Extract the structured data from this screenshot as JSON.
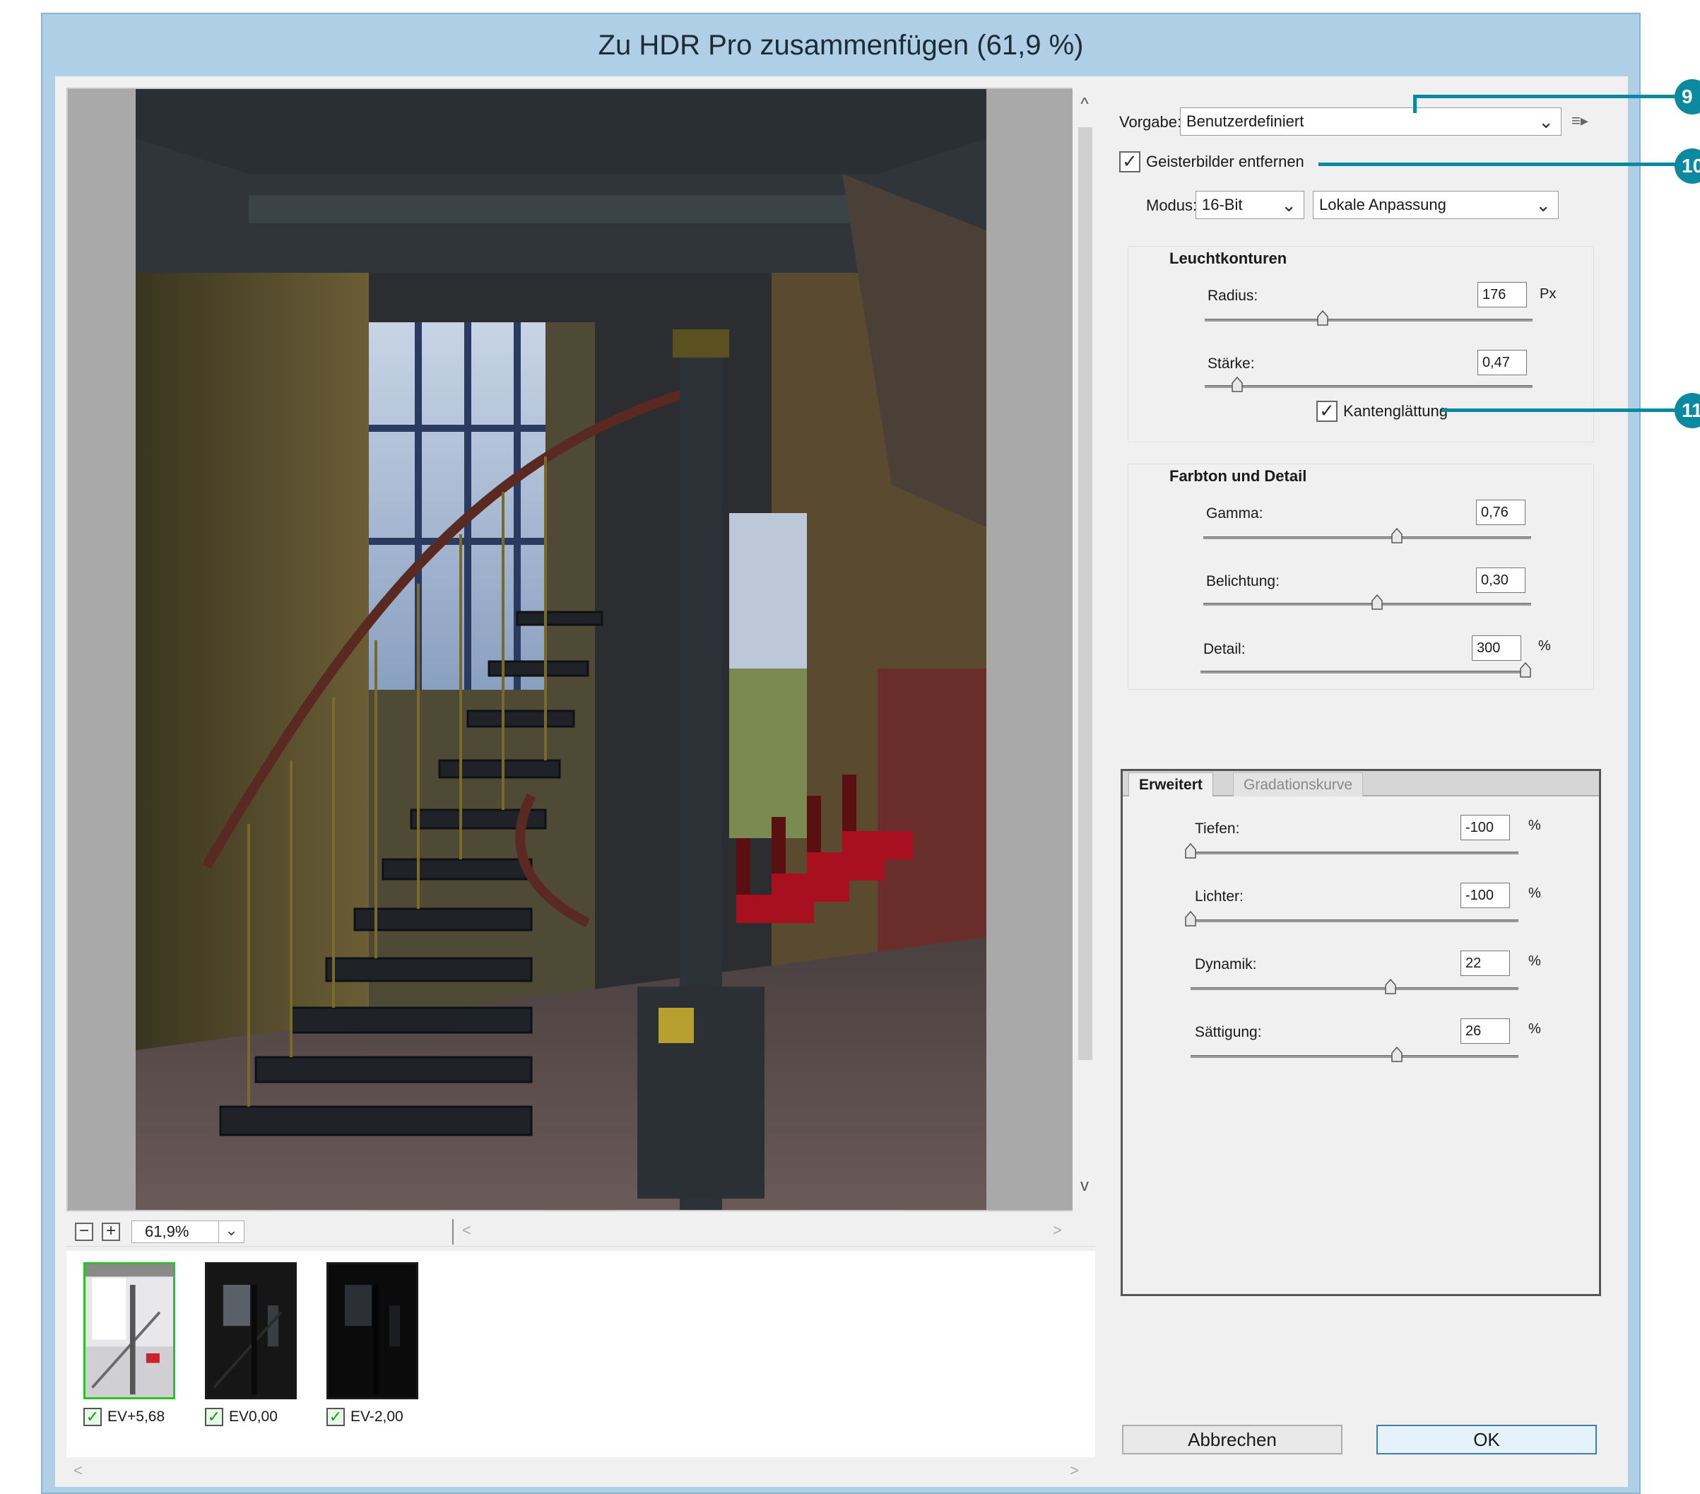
{
  "window": {
    "title": "Zu HDR Pro zusammenfügen (61,9 %)"
  },
  "preview": {
    "zoom_value": "61,9%",
    "zoom_out_symbol": "−",
    "zoom_in_symbol": "+",
    "scroll_up_symbol": "^",
    "scroll_down_symbol": "v",
    "scroll_left_symbol": "<",
    "scroll_right_symbol": ">"
  },
  "filmstrip": {
    "items": [
      {
        "label": "EV+5,68",
        "checked": true,
        "selected": true
      },
      {
        "label": "EV0,00",
        "checked": true,
        "selected": false
      },
      {
        "label": "EV-2,00",
        "checked": true,
        "selected": false
      }
    ]
  },
  "settings": {
    "preset_label": "Vorgabe:",
    "preset_value": "Benutzerdefiniert",
    "preset_menu_icon": "menu-lines-icon",
    "remove_ghosts_label": "Geisterbilder entfernen",
    "remove_ghosts_checked": true,
    "mode_label": "Modus:",
    "bit_depth": "16-Bit",
    "method": "Lokale Anpassung"
  },
  "edge_glow": {
    "title": "Leuchtkonturen",
    "radius": {
      "label": "Radius:",
      "value": "176",
      "unit": "Px",
      "fraction": 0.36
    },
    "strength": {
      "label": "Stärke:",
      "value": "0,47",
      "fraction": 0.1
    },
    "smooth_edges_label": "Kantenglättung",
    "smooth_edges_checked": true
  },
  "tone_detail": {
    "title": "Farbton und Detail",
    "gamma": {
      "label": "Gamma:",
      "value": "0,76",
      "fraction": 0.59
    },
    "exposure": {
      "label": "Belichtung:",
      "value": "0,30",
      "fraction": 0.53
    },
    "detail": {
      "label": "Detail:",
      "value": "300",
      "unit": "%",
      "fraction": 1.0
    }
  },
  "advanced": {
    "tab_active": "Erweitert",
    "tab_inactive": "Gradationskurve",
    "shadows": {
      "label": "Tiefen:",
      "value": "-100",
      "unit": "%",
      "fraction": 0.0
    },
    "highlights": {
      "label": "Lichter:",
      "value": "-100",
      "unit": "%",
      "fraction": 0.0
    },
    "vibrance": {
      "label": "Dynamik:",
      "value": "22",
      "unit": "%",
      "fraction": 0.61
    },
    "saturation": {
      "label": "Sättigung:",
      "value": "26",
      "unit": "%",
      "fraction": 0.63
    }
  },
  "buttons": {
    "cancel": "Abbrechen",
    "ok": "OK"
  },
  "callouts": {
    "c9": "9",
    "c10": "10",
    "c11": "11"
  },
  "colors": {
    "callout": "#0a8aa0",
    "selection": "#29c229",
    "titlebar": "#aecfe6"
  }
}
